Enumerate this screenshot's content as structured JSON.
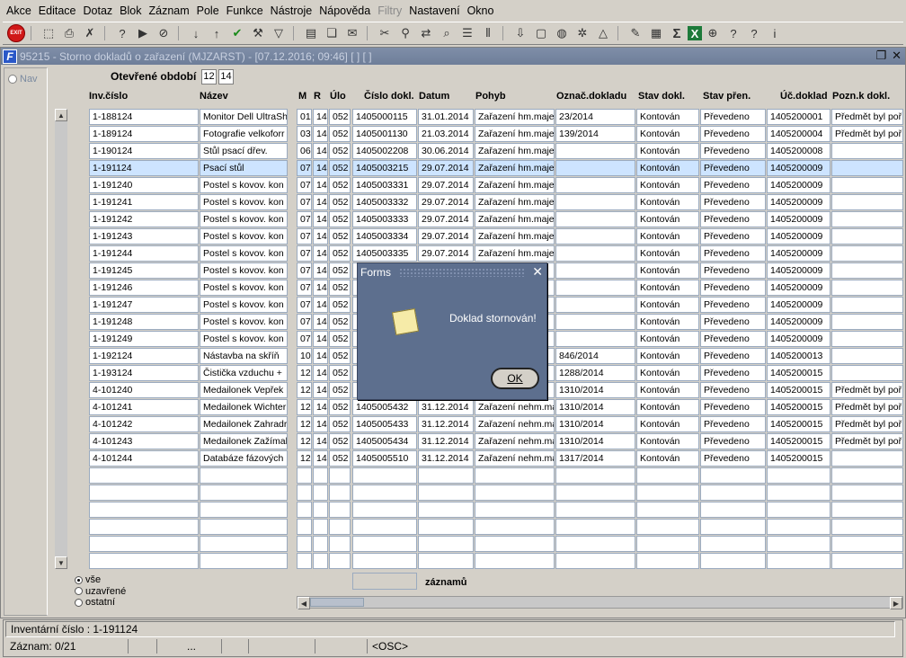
{
  "menu": [
    {
      "label": "Akce",
      "disabled": false
    },
    {
      "label": "Editace",
      "disabled": false
    },
    {
      "label": "Dotaz",
      "disabled": false
    },
    {
      "label": "Blok",
      "disabled": false
    },
    {
      "label": "Záznam",
      "disabled": false
    },
    {
      "label": "Pole",
      "disabled": false
    },
    {
      "label": "Funkce",
      "disabled": false
    },
    {
      "label": "Nástroje",
      "disabled": false
    },
    {
      "label": "Nápověda",
      "disabled": false
    },
    {
      "label": "Filtry",
      "disabled": true
    },
    {
      "label": "Nastavení",
      "disabled": false
    },
    {
      "label": "Okno",
      "disabled": false
    }
  ],
  "toolbar": {
    "exit_label": "EXIT",
    "icons": [
      "save-icon",
      "print-icon",
      "delete-record-icon",
      "sep",
      "query-icon",
      "query-run-icon",
      "cancel-query-icon",
      "sep",
      "sort-asc-icon",
      "sort-desc-icon",
      "check-icon",
      "tools-icon",
      "filter-icon",
      "sep",
      "document-icon",
      "copy-icon",
      "mail-icon",
      "sep",
      "cut-icon",
      "link-icon",
      "export-icon",
      "search-tree-icon",
      "list-icon",
      "columns-icon",
      "sep",
      "import-icon",
      "page-icon",
      "globe-icon",
      "settings-icon",
      "chart-icon",
      "sep",
      "edit-icon",
      "notes-icon",
      "sum-icon",
      "excel-icon",
      "world-icon",
      "help-icon",
      "help-query-icon",
      "info-icon"
    ]
  },
  "window": {
    "title": "95215 - Storno dokladů o zařazení (MJZARST) - [07.12.2016; 09:46] [ ] [ ]",
    "nav_label": "Nav",
    "period_label": "Otevřené období",
    "period_month": "12",
    "period_year": "14"
  },
  "grid": {
    "headers": [
      "Inv.číslo",
      "Název",
      "M",
      "R",
      "Úlo",
      "Číslo dokl.",
      "Datum",
      "Pohyb",
      "Označ.dokladu",
      "Stav dokl.",
      "Stav přen.",
      "Úč.doklad",
      "Pozn.k dokl."
    ],
    "rows": [
      {
        "inv": "1-188124",
        "nazev": "Monitor Dell UltraSh",
        "m": "01",
        "r": "14",
        "ulo": "052",
        "cislo": "1405000115",
        "datum": "31.01.2014",
        "pohyb": "Zařazení hm.maje",
        "oznac": "23/2014",
        "stav": "Kontován",
        "stavp": "Převedeno",
        "uc": "1405200001",
        "pozn": "Předmět byl poř"
      },
      {
        "inv": "1-189124",
        "nazev": "Fotografie velkoforr",
        "m": "03",
        "r": "14",
        "ulo": "052",
        "cislo": "1405001130",
        "datum": "21.03.2014",
        "pohyb": "Zařazení hm.maje",
        "oznac": "139/2014",
        "stav": "Kontován",
        "stavp": "Převedeno",
        "uc": "1405200004",
        "pozn": "Předmět byl poř"
      },
      {
        "inv": "1-190124",
        "nazev": "Stůl psací dřev.",
        "m": "06",
        "r": "14",
        "ulo": "052",
        "cislo": "1405002208",
        "datum": "30.06.2014",
        "pohyb": "Zařazení hm.maje",
        "oznac": "",
        "stav": "Kontován",
        "stavp": "Převedeno",
        "uc": "1405200008",
        "pozn": ""
      },
      {
        "inv": "1-191124",
        "nazev": "Psací stůl",
        "m": "07",
        "r": "14",
        "ulo": "052",
        "cislo": "1405003215",
        "datum": "29.07.2014",
        "pohyb": "Zařazení hm.maje",
        "oznac": "",
        "stav": "Kontován",
        "stavp": "Převedeno",
        "uc": "1405200009",
        "pozn": ""
      },
      {
        "inv": "1-191240",
        "nazev": "Postel s kovov. kon",
        "m": "07",
        "r": "14",
        "ulo": "052",
        "cislo": "1405003331",
        "datum": "29.07.2014",
        "pohyb": "Zařazení hm.maje",
        "oznac": "",
        "stav": "Kontován",
        "stavp": "Převedeno",
        "uc": "1405200009",
        "pozn": ""
      },
      {
        "inv": "1-191241",
        "nazev": "Postel s kovov. kon",
        "m": "07",
        "r": "14",
        "ulo": "052",
        "cislo": "1405003332",
        "datum": "29.07.2014",
        "pohyb": "Zařazení hm.maje",
        "oznac": "",
        "stav": "Kontován",
        "stavp": "Převedeno",
        "uc": "1405200009",
        "pozn": ""
      },
      {
        "inv": "1-191242",
        "nazev": "Postel s kovov. kon",
        "m": "07",
        "r": "14",
        "ulo": "052",
        "cislo": "1405003333",
        "datum": "29.07.2014",
        "pohyb": "Zařazení hm.maje",
        "oznac": "",
        "stav": "Kontován",
        "stavp": "Převedeno",
        "uc": "1405200009",
        "pozn": ""
      },
      {
        "inv": "1-191243",
        "nazev": "Postel s kovov. kon",
        "m": "07",
        "r": "14",
        "ulo": "052",
        "cislo": "1405003334",
        "datum": "29.07.2014",
        "pohyb": "Zařazení hm.maje",
        "oznac": "",
        "stav": "Kontován",
        "stavp": "Převedeno",
        "uc": "1405200009",
        "pozn": ""
      },
      {
        "inv": "1-191244",
        "nazev": "Postel s kovov. kon",
        "m": "07",
        "r": "14",
        "ulo": "052",
        "cislo": "1405003335",
        "datum": "29.07.2014",
        "pohyb": "Zařazení hm.maje",
        "oznac": "",
        "stav": "Kontován",
        "stavp": "Převedeno",
        "uc": "1405200009",
        "pozn": ""
      },
      {
        "inv": "1-191245",
        "nazev": "Postel s kovov. kon",
        "m": "07",
        "r": "14",
        "ulo": "052",
        "cislo": "",
        "datum": "",
        "pohyb": "",
        "oznac": "",
        "stav": "Kontován",
        "stavp": "Převedeno",
        "uc": "1405200009",
        "pozn": ""
      },
      {
        "inv": "1-191246",
        "nazev": "Postel s kovov. kon",
        "m": "07",
        "r": "14",
        "ulo": "052",
        "cislo": "",
        "datum": "",
        "pohyb": "",
        "oznac": "",
        "stav": "Kontován",
        "stavp": "Převedeno",
        "uc": "1405200009",
        "pozn": ""
      },
      {
        "inv": "1-191247",
        "nazev": "Postel s kovov. kon",
        "m": "07",
        "r": "14",
        "ulo": "052",
        "cislo": "",
        "datum": "",
        "pohyb": "",
        "oznac": "",
        "stav": "Kontován",
        "stavp": "Převedeno",
        "uc": "1405200009",
        "pozn": ""
      },
      {
        "inv": "1-191248",
        "nazev": "Postel s kovov. kon",
        "m": "07",
        "r": "14",
        "ulo": "052",
        "cislo": "",
        "datum": "",
        "pohyb": "",
        "oznac": "",
        "stav": "Kontován",
        "stavp": "Převedeno",
        "uc": "1405200009",
        "pozn": ""
      },
      {
        "inv": "1-191249",
        "nazev": "Postel s kovov. kon",
        "m": "07",
        "r": "14",
        "ulo": "052",
        "cislo": "",
        "datum": "",
        "pohyb": "",
        "oznac": "",
        "stav": "Kontován",
        "stavp": "Převedeno",
        "uc": "1405200009",
        "pozn": ""
      },
      {
        "inv": "1-192124",
        "nazev": "Nástavba na skříň",
        "m": "10",
        "r": "14",
        "ulo": "052",
        "cislo": "",
        "datum": "",
        "pohyb": "",
        "oznac": "846/2014",
        "stav": "Kontován",
        "stavp": "Převedeno",
        "uc": "1405200013",
        "pozn": ""
      },
      {
        "inv": "1-193124",
        "nazev": "Čistička vzduchu +",
        "m": "12",
        "r": "14",
        "ulo": "052",
        "cislo": "",
        "datum": "",
        "pohyb": "",
        "oznac": "1288/2014",
        "stav": "Kontován",
        "stavp": "Převedeno",
        "uc": "1405200015",
        "pozn": ""
      },
      {
        "inv": "4-101240",
        "nazev": "Medailonek Vepřek",
        "m": "12",
        "r": "14",
        "ulo": "052",
        "cislo": "",
        "datum": "",
        "pohyb": "",
        "oznac": "1310/2014",
        "stav": "Kontován",
        "stavp": "Převedeno",
        "uc": "1405200015",
        "pozn": "Předmět byl poř"
      },
      {
        "inv": "4-101241",
        "nazev": "Medailonek Wichter",
        "m": "12",
        "r": "14",
        "ulo": "052",
        "cislo": "1405005432",
        "datum": "31.12.2014",
        "pohyb": "Zařazení nehm.ma",
        "oznac": "1310/2014",
        "stav": "Kontován",
        "stavp": "Převedeno",
        "uc": "1405200015",
        "pozn": "Předmět byl poř"
      },
      {
        "inv": "4-101242",
        "nazev": "Medailonek Zahradr",
        "m": "12",
        "r": "14",
        "ulo": "052",
        "cislo": "1405005433",
        "datum": "31.12.2014",
        "pohyb": "Zařazení nehm.ma",
        "oznac": "1310/2014",
        "stav": "Kontován",
        "stavp": "Převedeno",
        "uc": "1405200015",
        "pozn": "Předmět byl poř"
      },
      {
        "inv": "4-101243",
        "nazev": "Medailonek Zažímal",
        "m": "12",
        "r": "14",
        "ulo": "052",
        "cislo": "1405005434",
        "datum": "31.12.2014",
        "pohyb": "Zařazení nehm.ma",
        "oznac": "1310/2014",
        "stav": "Kontován",
        "stavp": "Převedeno",
        "uc": "1405200015",
        "pozn": "Předmět byl poř"
      },
      {
        "inv": "4-101244",
        "nazev": "Databáze fázových",
        "m": "12",
        "r": "14",
        "ulo": "052",
        "cislo": "1405005510",
        "datum": "31.12.2014",
        "pohyb": "Zařazení nehm.ma",
        "oznac": "1317/2014",
        "stav": "Kontován",
        "stavp": "Převedeno",
        "uc": "1405200015",
        "pozn": ""
      }
    ],
    "selected_index": 3,
    "empty_rows": 6
  },
  "filter": {
    "options": [
      "vše",
      "uzavřené",
      "ostatní"
    ],
    "selected": "vše",
    "count_label": "záznamů"
  },
  "dialog": {
    "title": "Forms",
    "message": "Doklad stornován!",
    "ok_label": "OK"
  },
  "status": {
    "field_text": "Inventární číslo : 1-191124",
    "record": "Záznam: 0/21",
    "ellipsis": "...",
    "mode": "<OSC>"
  },
  "colors": {
    "title_bar": "#6e7e99",
    "selected_row": "#cde4ff",
    "dialog_bg": "#5d6f8e",
    "exit_button": "#d01818"
  }
}
